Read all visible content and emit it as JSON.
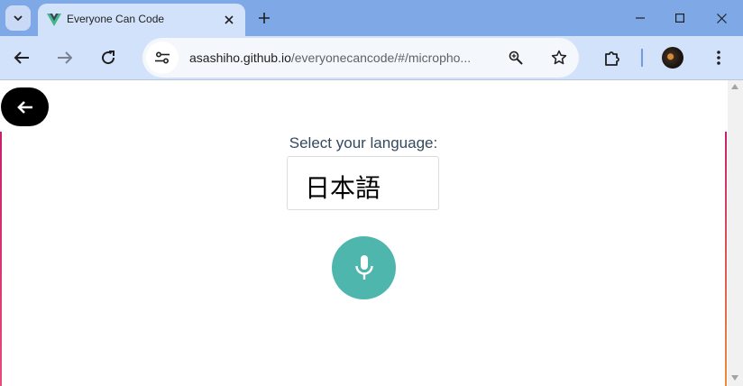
{
  "browser": {
    "tab": {
      "title": "Everyone Can Code"
    },
    "address": {
      "host": "asashiho.github.io",
      "path": "/everyonecancode/#/micropho..."
    }
  },
  "page": {
    "language_label": "Select your language:",
    "selected_language": "日本語"
  },
  "icons": {
    "tab_search": "chevron-down-icon",
    "favicon": "vue-logo-icon",
    "tab_close": "close-icon",
    "new_tab": "plus-icon",
    "minimize": "minimize-icon",
    "maximize": "maximize-icon",
    "close_window": "close-icon",
    "back": "arrow-left-icon",
    "forward": "arrow-right-icon",
    "reload": "reload-icon",
    "site_info": "tune-icon",
    "zoom": "zoom-icon",
    "bookmark": "star-icon",
    "extensions": "puzzle-icon",
    "profile": "avatar",
    "menu": "more-vert-icon",
    "page_back": "arrow-left-icon",
    "mic": "microphone-icon"
  },
  "colors": {
    "titlebar": "#7fa8e6",
    "toolbar": "#d3e2fb",
    "mic_button": "#4fb6ad",
    "back_pill": "#000000",
    "label_text": "#34495e"
  }
}
